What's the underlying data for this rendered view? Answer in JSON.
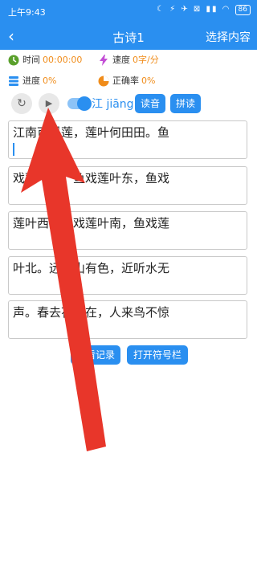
{
  "status": {
    "time": "上午9:43",
    "icons_text": "☾ ⚡ ✈ ⊠ ▮▮ ◠",
    "battery": "86"
  },
  "appbar": {
    "back_glyph": "‹",
    "title": "古诗1",
    "right_action": "选择内容"
  },
  "stats": {
    "time_label": "时间",
    "time_value": "00:00:00",
    "speed_label": "速度",
    "speed_value": "0字/分",
    "progress_label": "进度",
    "progress_value": "0%",
    "accuracy_label": "正确率",
    "accuracy_value": "0%"
  },
  "controls": {
    "reset_glyph": "↻",
    "play_glyph": "▶",
    "pinyin_char": "江",
    "pinyin_text": "jiāng",
    "read_label": "读音",
    "spell_label": "拼读"
  },
  "lines": [
    "江南可采莲，莲叶何田田。鱼",
    "戏莲叶间。鱼戏莲叶东，鱼戏",
    "莲叶西，鱼戏莲叶南，鱼戏莲",
    "叶北。远看山有色，近听水无",
    "声。春去花还在，人来鸟不惊"
  ],
  "bottom": {
    "records_label": "查看记录",
    "symbols_label": "打开符号栏"
  },
  "colors": {
    "accent": "#2a8ff0",
    "value": "#f08c1a",
    "arrow": "#e8362a"
  }
}
